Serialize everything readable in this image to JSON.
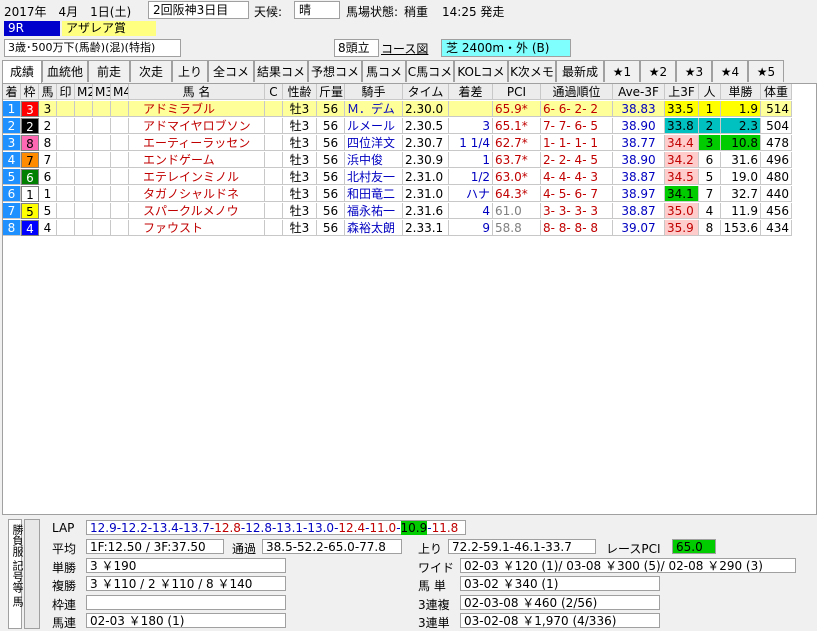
{
  "header": {
    "date": "2017年　4月　1日(土)",
    "meeting": "2回阪神3日目",
    "weather_label": "天候:",
    "weather": "晴",
    "track_label": "馬場状態:",
    "track": "稍重",
    "post_time": "14:25 発走",
    "race_no": "9R",
    "race_name": "アザレア賞",
    "conditions": "3歳･500万下(馬齢)(混)(特指)",
    "runners": "8頭立",
    "course_label": "コース図",
    "course": "芝 2400m・外 (B)"
  },
  "tabs": [
    "成績",
    "血統他",
    "前走",
    "次走",
    "上り",
    "全コメ",
    "結果コメ",
    "予想コメ",
    "馬コメ",
    "C馬コメ",
    "KOLコメ",
    "K次メモ",
    "最新成",
    "★1",
    "★2",
    "★3",
    "★4",
    "★5"
  ],
  "columns": [
    "着",
    "枠",
    "馬",
    "印",
    "M2",
    "M3",
    "M4",
    "馬 名",
    "C",
    "性齢",
    "斤量",
    "騎手",
    "タイム",
    "着差",
    "PCI",
    "通過順位",
    "Ave-3F",
    "上3F",
    "人",
    "単勝",
    "体重"
  ],
  "rows": [
    {
      "rank": "1",
      "waku": "3",
      "umaban": "3",
      "name": "アドミラブル",
      "sexage": "牡3",
      "weight": "56",
      "jockey": "Ｍ．デム",
      "time": "2.30.0",
      "margin": "",
      "pci": "65.9*",
      "passing": "6- 6- 2- 2",
      "ave3f": "38.83",
      "last3f": "33.5",
      "pop": "1",
      "odds": "1.9",
      "bw": "514"
    },
    {
      "rank": "2",
      "waku": "2",
      "umaban": "2",
      "name": "アドマイヤロブソン",
      "sexage": "牡3",
      "weight": "56",
      "jockey": "ルメール",
      "time": "2.30.5",
      "margin": "3",
      "pci": "65.1*",
      "passing": "7- 7- 6- 5",
      "ave3f": "38.90",
      "last3f": "33.8",
      "pop": "2",
      "odds": "2.3",
      "bw": "504"
    },
    {
      "rank": "3",
      "waku": "8",
      "umaban": "8",
      "name": "エーティーラッセン",
      "sexage": "牡3",
      "weight": "56",
      "jockey": "四位洋文",
      "time": "2.30.7",
      "margin": "1 1/4",
      "pci": "62.7*",
      "passing": "1- 1- 1- 1",
      "ave3f": "38.77",
      "last3f": "34.4",
      "pop": "3",
      "odds": "10.8",
      "bw": "478"
    },
    {
      "rank": "4",
      "waku": "7",
      "umaban": "7",
      "name": "エンドゲーム",
      "sexage": "牡3",
      "weight": "56",
      "jockey": "浜中俊",
      "time": "2.30.9",
      "margin": "1",
      "pci": "63.7*",
      "passing": "2- 2- 4- 5",
      "ave3f": "38.90",
      "last3f": "34.2",
      "pop": "6",
      "odds": "31.6",
      "bw": "496"
    },
    {
      "rank": "5",
      "waku": "6",
      "umaban": "6",
      "name": "エテレインミノル",
      "sexage": "牡3",
      "weight": "56",
      "jockey": "北村友一",
      "time": "2.31.0",
      "margin": "1/2",
      "pci": "63.0*",
      "passing": "4- 4- 4- 3",
      "ave3f": "38.87",
      "last3f": "34.5",
      "pop": "5",
      "odds": "19.0",
      "bw": "480"
    },
    {
      "rank": "6",
      "waku": "1",
      "umaban": "1",
      "name": "タガノシャルドネ",
      "sexage": "牡3",
      "weight": "56",
      "jockey": "和田竜二",
      "time": "2.31.0",
      "margin": "ハナ",
      "pci": "64.3*",
      "passing": "4- 5- 6- 7",
      "ave3f": "38.97",
      "last3f": "34.1",
      "pop": "7",
      "odds": "32.7",
      "bw": "440"
    },
    {
      "rank": "7",
      "waku": "5",
      "umaban": "5",
      "name": "スパークルメノウ",
      "sexage": "牡3",
      "weight": "56",
      "jockey": "福永祐一",
      "time": "2.31.6",
      "margin": "4",
      "pci": "61.0",
      "passing": "3- 3- 3- 3",
      "ave3f": "38.87",
      "last3f": "35.0",
      "pop": "4",
      "odds": "11.9",
      "bw": "456"
    },
    {
      "rank": "8",
      "waku": "4",
      "umaban": "4",
      "name": "ファウスト",
      "sexage": "牡3",
      "weight": "56",
      "jockey": "森裕太朗",
      "time": "2.33.1",
      "margin": "9",
      "pci": "58.8",
      "passing": "8- 8- 8- 8",
      "ave3f": "39.07",
      "last3f": "35.9",
      "pop": "8",
      "odds": "153.6",
      "bw": "434"
    }
  ],
  "colors": {
    "rank_bg": "#1e90ff",
    "waku": {
      "1": "#ffffff",
      "2": "#000000",
      "3": "#ff0000",
      "4": "#0000ff",
      "5": "#ffff00",
      "6": "#008000",
      "7": "#ff8c00",
      "8": "#ff69b4"
    },
    "first_row_bg": "#ffff99",
    "top3f_1": "#ffff00",
    "top3f_2": "#00c0c0",
    "top3f_3": "#ffd700",
    "top3f_fast": "#00cc00",
    "last3f_pink": "#ffcccc"
  },
  "bottom": {
    "side_labels": [
      "勝負服",
      "記号等",
      "除外馬"
    ],
    "lap_label": "LAP",
    "lap_parts": [
      {
        "t": "12.9-12.2-13.4-13.7-",
        "c": "blue"
      },
      {
        "t": "12.8",
        "c": "red"
      },
      {
        "t": "-12.8-13.1-13.0-",
        "c": "blue"
      },
      {
        "t": "12.4",
        "c": "red"
      },
      {
        "t": "-",
        "c": "blue"
      },
      {
        "t": "11.0",
        "c": "red"
      },
      {
        "t": "-",
        "c": "blue"
      },
      {
        "t": "10.9",
        "c": "greenbg"
      },
      {
        "t": "-",
        "c": "blue"
      },
      {
        "t": "11.8",
        "c": "red"
      }
    ],
    "avg_label": "平均",
    "avg_value": "1F:12.50 / 3F:37.50",
    "passing_label": "通過",
    "passing_value": "38.5-52.2-65.0-77.8",
    "agari_label": "上り",
    "agari_value": "72.2-59.1-46.1-33.7",
    "racepci_label": "レースPCI",
    "racepci_value": "65.0",
    "tansho_label": "単勝",
    "tansho_value": "3 ￥190",
    "fukusho_label": "複勝",
    "fukusho_value": "3 ￥110 / 2 ￥110 / 8 ￥140",
    "wakuren_label": "枠連",
    "wakuren_value": "",
    "umaren_label": "馬連",
    "umaren_value": "02-03 ￥180 (1)",
    "wide_label": "ワイド",
    "wide_value": "02-03 ￥120 (1)/ 03-08 ￥300 (5)/ 02-08 ￥290 (3)",
    "umatan_label": "馬 単",
    "umatan_value": "03-02 ￥340 (1)",
    "sanrenpuku_label": "3連複",
    "sanrenpuku_value": "02-03-08 ￥460 (2/56)",
    "sanrentan_label": "3連単",
    "sanrentan_value": "03-02-08 ￥1,970 (4/336)"
  }
}
